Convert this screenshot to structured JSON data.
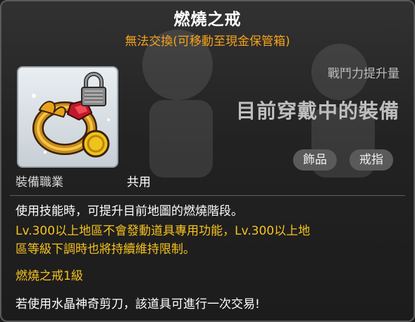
{
  "item": {
    "name": "燃燒之戒",
    "trade_note": "無法交換(可移動至現金保管箱)",
    "power_label": "戰鬥力提升量",
    "equipped_label": "目前穿戴中的裝備",
    "category": "飾品",
    "subcategory": "戒指",
    "job_label": "裝備職業",
    "job_value": "共用",
    "icon": "burning-ring-icon",
    "lock_icon": "lock-icon"
  },
  "description": {
    "line1": "使用技能時，可提升目前地圖的燃燒階段。",
    "line2": "Lv.300以上地區不會發動道具專用功能，Lv.300以上地",
    "line3": "區等級下調時也將持續維持限制。",
    "level_line": "燃燒之戒1級",
    "scissors_line": "若使用水晶神奇剪刀，該道具可進行一次交易!"
  },
  "colors": {
    "title": "#ffffff",
    "trade_note": "#f6a21a",
    "yellow_text": "#f7c21e",
    "background": "#262626"
  }
}
